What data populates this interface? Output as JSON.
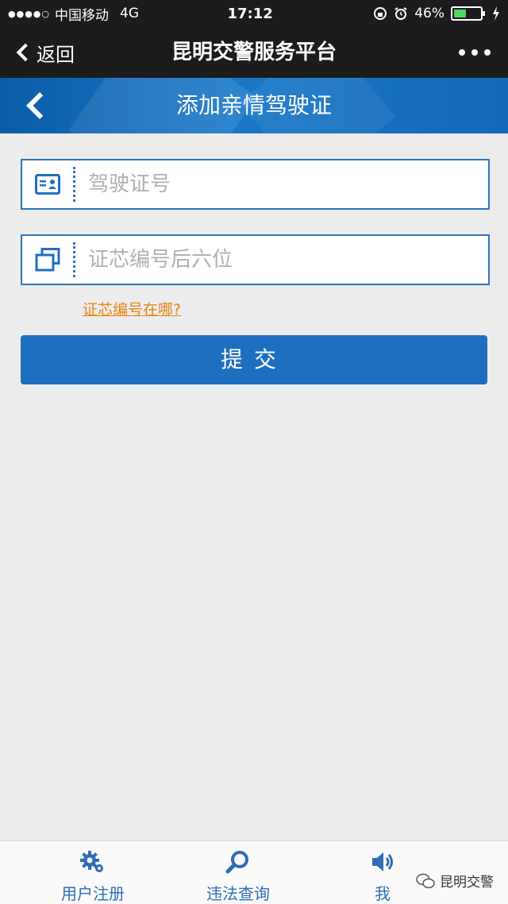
{
  "status_bar": {
    "carrier": "中国移动",
    "network": "4G",
    "time": "17:12",
    "battery_percent": "46%",
    "battery_level": 0.46
  },
  "nav": {
    "back_label": "返回",
    "title": "昆明交警服务平台"
  },
  "subheader": {
    "title": "添加亲情驾驶证"
  },
  "form": {
    "license_placeholder": "驾驶证号",
    "chip_placeholder": "证芯编号后六位",
    "help_link": "证芯编号在哪?",
    "submit_label": "提交"
  },
  "tabbar": {
    "items": [
      {
        "label": "用户注册",
        "icon": "gear-icon"
      },
      {
        "label": "违法查询",
        "icon": "search-icon"
      },
      {
        "label": "我",
        "icon": "speaker-icon"
      }
    ]
  },
  "watermark": {
    "text": "昆明交警"
  },
  "colors": {
    "accent": "#1e6fc0",
    "link": "#e8840f",
    "dark_bar": "#1c1c1e"
  }
}
